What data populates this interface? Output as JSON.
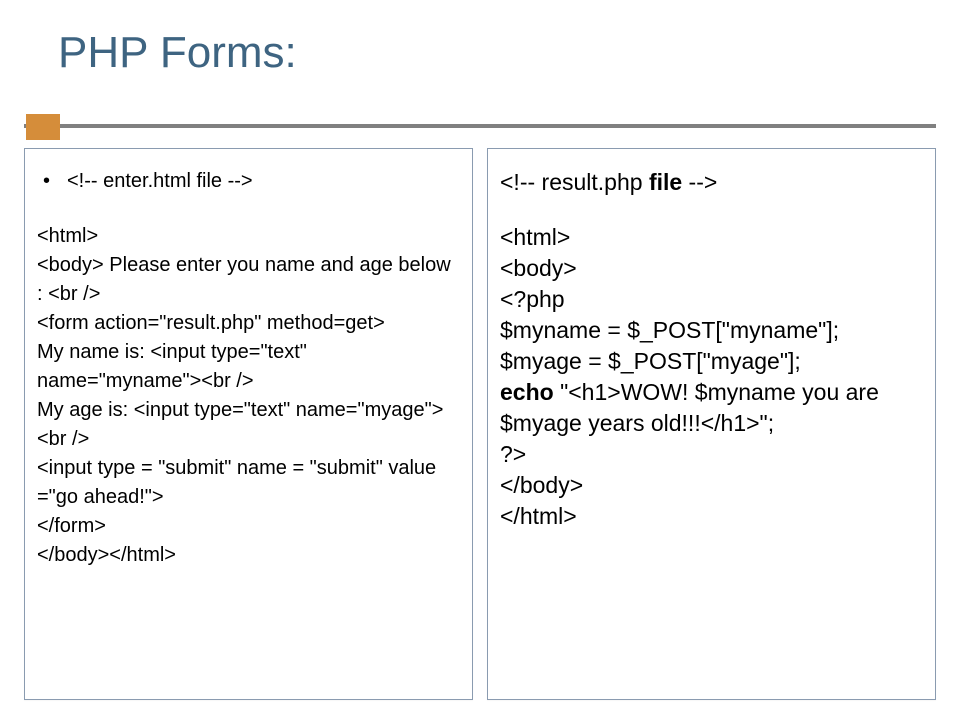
{
  "title": "PHP Forms:",
  "left": {
    "l1": "<!-- enter.html file -->",
    "l2": "<html>",
    "l3": "<body>   Please enter you name and age below : <br />",
    "l4": "<form action=\"result.php\" method=get>",
    "l5": "My name is:  <input type=\"text\" name=\"myname\"><br />",
    "l6": " My age is:  <input type=\"text\" name=\"myage\"><br />",
    "l7": "<input type = \"submit\" name = \"submit\" value =\"go ahead!\">",
    "l8": "</form>",
    "l9": "</body></html>"
  },
  "right": {
    "r1a": "<!-- result.php ",
    "r1b": "file",
    "r1c": " -->",
    "r2": "<html>",
    "r3": "<body>",
    "r4": "<?php",
    "r5": "$myname = $_POST[\"myname\"];",
    "r6": "$myage = $_POST[\"myage\"];",
    "r7a": "echo ",
    "r7b": "\"<h1>WOW! $myname you are $myage years old!!!</h1>\";",
    "r8": "?>",
    "r9": "</body>",
    "r10": "</html>"
  }
}
